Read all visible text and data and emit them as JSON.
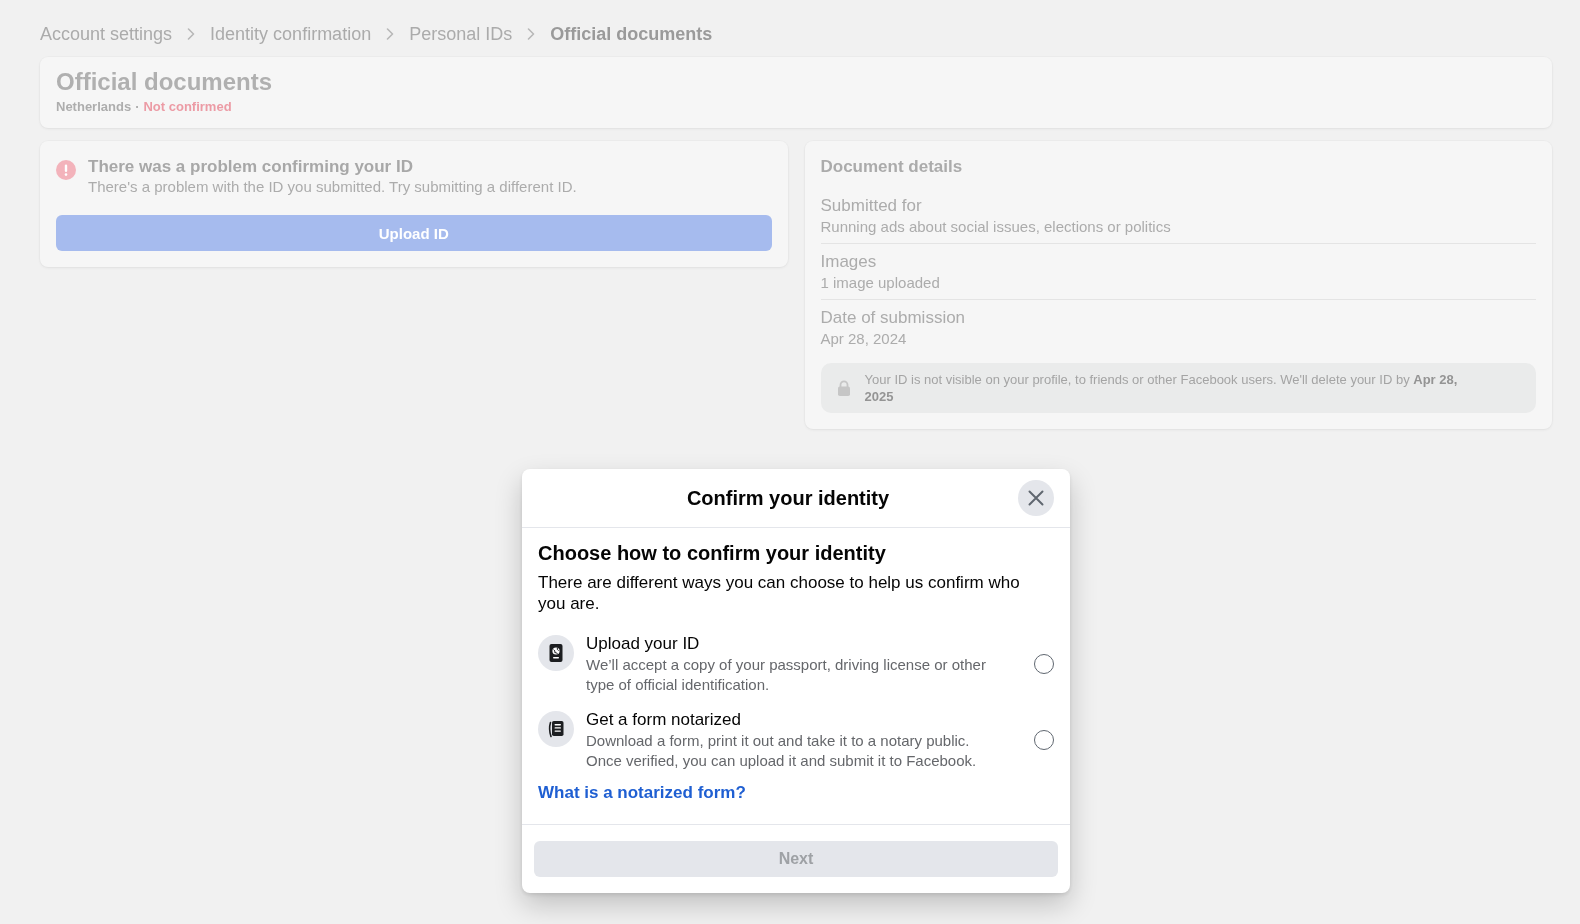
{
  "breadcrumb": [
    {
      "label": "Account settings",
      "current": false
    },
    {
      "label": "Identity confirmation",
      "current": false
    },
    {
      "label": "Personal IDs",
      "current": false
    },
    {
      "label": "Official documents",
      "current": true
    }
  ],
  "header": {
    "title": "Official documents",
    "country": "Netherlands",
    "separator": "·",
    "status": "Not confirmed"
  },
  "problem": {
    "title": "There was a problem confirming your ID",
    "description": "There's a problem with the ID you submitted. Try submitting a different ID.",
    "button": "Upload ID"
  },
  "details": {
    "title": "Document details",
    "rows": [
      {
        "label": "Submitted for",
        "value": "Running ads about social issues, elections or politics"
      },
      {
        "label": "Images",
        "value": "1 image uploaded"
      },
      {
        "label": "Date of submission",
        "value": "Apr 28, 2024"
      }
    ],
    "notice": "Your ID is not visible on your profile, to friends or other Facebook users. We'll delete your ID by **Apr 28, 2025**"
  },
  "dialog": {
    "title": "Confirm your identity",
    "heading": "Choose how to confirm your identity",
    "description": "There are different ways you can choose to help us confirm who you are.",
    "options": [
      {
        "kind": "passport",
        "title": "Upload your ID",
        "description": "We’ll accept a copy of your passport, driving license or other type of official identification.",
        "selected": false
      },
      {
        "kind": "form",
        "title": "Get a form notarized",
        "description": "Download a form, print it out and take it to a notary public. Once verified, you can upload it and submit it to Facebook.",
        "selected": false
      }
    ],
    "link": "What is a notarized form?",
    "next_button": {
      "label": "Next",
      "disabled": true
    }
  }
}
